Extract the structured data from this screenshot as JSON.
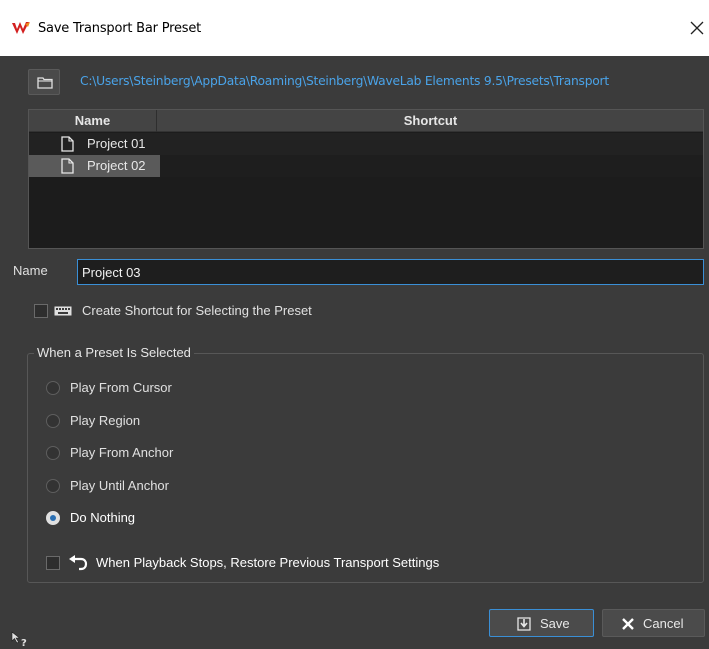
{
  "window": {
    "title": "Save Transport Bar Preset",
    "close_label": "✕",
    "app_icon": "wavelab-logo-icon"
  },
  "path": {
    "folder_icon": "folder-icon",
    "text": "C:\\Users\\Steinberg\\AppData\\Roaming\\Steinberg\\WaveLab Elements 9.5\\Presets\\Transport"
  },
  "table": {
    "columns": [
      "Name",
      "Shortcut"
    ],
    "rows": [
      {
        "name": "Project 01",
        "shortcut": "",
        "selected": false
      },
      {
        "name": "Project 02",
        "shortcut": "",
        "selected": true
      }
    ]
  },
  "name_field": {
    "label": "Name",
    "value": "Project 03"
  },
  "create_shortcut": {
    "label": "Create Shortcut for Selecting the Preset",
    "checked": false,
    "icon": "keyboard-icon"
  },
  "group": {
    "title": "When a Preset Is Selected",
    "options": [
      {
        "label": "Play From Cursor",
        "checked": false
      },
      {
        "label": "Play Region",
        "checked": false
      },
      {
        "label": "Play From Anchor",
        "checked": false
      },
      {
        "label": "Play Until Anchor",
        "checked": false
      },
      {
        "label": "Do Nothing",
        "checked": true
      }
    ],
    "restore": {
      "label": "When Playback Stops, Restore Previous Transport Settings",
      "checked": false,
      "icon": "undo-icon"
    }
  },
  "buttons": {
    "save": "Save",
    "cancel": "Cancel"
  },
  "colors": {
    "accent": "#3a8fd6",
    "path_link": "#4aa3e8",
    "background": "#3b3b3b"
  }
}
